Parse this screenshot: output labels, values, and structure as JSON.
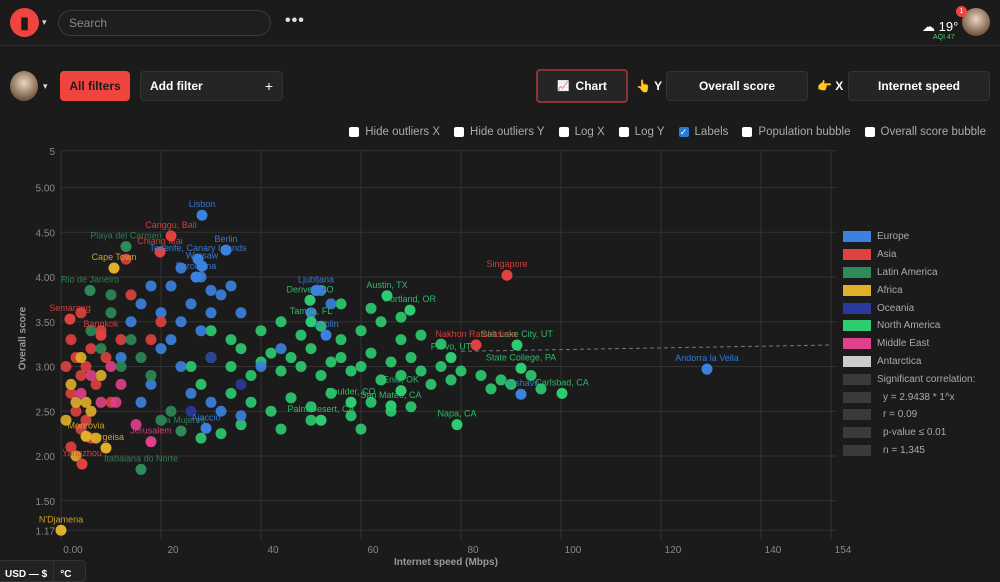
{
  "header": {
    "search_placeholder": "Search",
    "more": "•••",
    "temperature": "19°",
    "aqi": "AQI 47",
    "notifications": "1"
  },
  "toolbar": {
    "all_filters": "All filters",
    "add_filter": "Add filter",
    "add_icon": "+",
    "chart": "Chart",
    "chart_icon": "📈",
    "y_icon": "👆",
    "y_label": "Y",
    "y_value": "Overall score",
    "x_icon": "👉",
    "x_label": "X",
    "x_value": "Internet speed"
  },
  "options": [
    {
      "label": "Hide outliers X",
      "checked": false
    },
    {
      "label": "Hide outliers Y",
      "checked": false
    },
    {
      "label": "Log X",
      "checked": false
    },
    {
      "label": "Log Y",
      "checked": false
    },
    {
      "label": "Labels",
      "checked": true
    },
    {
      "label": "Population bubble",
      "checked": false
    },
    {
      "label": "Overall score bubble",
      "checked": false
    }
  ],
  "footer": {
    "currency": "USD — $",
    "unit": "°C"
  },
  "chart_data": {
    "type": "scatter",
    "xlabel": "Internet speed (Mbps)",
    "ylabel": "Overall score",
    "xlim": [
      0,
      154
    ],
    "ylim": [
      1.06,
      5.41
    ],
    "xticks": [
      {
        "v": 0,
        "t": "0.00"
      },
      {
        "v": 20,
        "t": "20"
      },
      {
        "v": 40,
        "t": "40"
      },
      {
        "v": 60,
        "t": "60"
      },
      {
        "v": 80,
        "t": "80"
      },
      {
        "v": 100,
        "t": "100"
      },
      {
        "v": 120,
        "t": "120"
      },
      {
        "v": 140,
        "t": "140"
      },
      {
        "v": 154,
        "t": "154"
      }
    ],
    "yticks": [
      {
        "v": 5.41,
        "t": "5"
      },
      {
        "v": 5,
        "t": "5.00"
      },
      {
        "v": 4.5,
        "t": "4.50"
      },
      {
        "v": 4,
        "t": "4.00"
      },
      {
        "v": 3.5,
        "t": "3.50"
      },
      {
        "v": 3,
        "t": "3.00"
      },
      {
        "v": 2.5,
        "t": "2.50"
      },
      {
        "v": 2,
        "t": "2.00"
      },
      {
        "v": 1.5,
        "t": "1.50"
      },
      {
        "v": 1.17,
        "t": "1.17"
      }
    ],
    "regions": [
      {
        "code": "E",
        "name": "Europe",
        "color": "#3b82e0"
      },
      {
        "code": "A",
        "name": "Asia",
        "color": "#e0433f"
      },
      {
        "code": "L",
        "name": "Latin America",
        "color": "#2e8a57"
      },
      {
        "code": "F",
        "name": "Africa",
        "color": "#e0b02a"
      },
      {
        "code": "O",
        "name": "Oceania",
        "color": "#2a3a9a"
      },
      {
        "code": "N",
        "name": "North America",
        "color": "#2ecc71"
      },
      {
        "code": "M",
        "name": "Middle East",
        "color": "#e0418a"
      },
      {
        "code": "X",
        "name": "Antarctica",
        "color": "#cccccc"
      }
    ],
    "correlation": [
      "Significant correlation:",
      "y = 2.9438 * 1^x",
      "r = 0.09",
      "p-value ≤ 0.01",
      "n = 1,345"
    ],
    "trendline": [
      [
        80,
        3.17
      ],
      [
        154,
        3.24
      ]
    ],
    "labeled_points": [
      [
        28.2,
        4.69,
        "E",
        "Lisbon"
      ],
      [
        22,
        4.46,
        "A",
        "Canggu, Bali"
      ],
      [
        13,
        4.34,
        "L",
        "Playa del Carmen"
      ],
      [
        19.8,
        4.28,
        "A",
        "Chiang Mai"
      ],
      [
        27.4,
        4.2,
        "E",
        "Tenerife, Canary Islands"
      ],
      [
        33,
        4.3,
        "E",
        "Berlin"
      ],
      [
        28.2,
        4.12,
        "E",
        "Warsaw"
      ],
      [
        10.6,
        4.1,
        "F",
        "Cape Town"
      ],
      [
        27,
        4.0,
        "E",
        "Barcelona"
      ],
      [
        89.2,
        4.02,
        "A",
        "Singapore"
      ],
      [
        65.2,
        3.79,
        "N",
        "Austin, TX"
      ],
      [
        69.8,
        3.63,
        "N",
        "Portland, OR"
      ],
      [
        91.2,
        3.24,
        "N",
        "Salt Lake City, UT"
      ],
      [
        129.2,
        2.97,
        "E",
        "Andorra la Vella"
      ],
      [
        100.2,
        2.7,
        "N",
        "Carlsbad, CA"
      ],
      [
        92,
        2.69,
        "E",
        "Torshavn"
      ],
      [
        79.2,
        2.35,
        "N",
        "Napa, CA"
      ],
      [
        49.8,
        3.74,
        "N",
        "Denver, CO"
      ],
      [
        51,
        3.85,
        "E",
        "Ljubljana"
      ],
      [
        18,
        2.16,
        "M",
        "Jerusalem"
      ],
      [
        5,
        2.22,
        "F",
        "Monrovia"
      ],
      [
        0,
        1.17,
        "F",
        "N'Djamena"
      ],
      [
        4.2,
        1.91,
        "A",
        "Yangzhou"
      ],
      [
        9,
        2.09,
        "F",
        "Hargeisa"
      ],
      [
        16,
        1.85,
        "L",
        "Itabaiana do Norte"
      ],
      [
        24,
        2.28,
        "L",
        "Isla Mujeres"
      ],
      [
        29,
        2.31,
        "E",
        "Ajaccio"
      ],
      [
        1.8,
        3.53,
        "A",
        "Semarang"
      ],
      [
        83,
        3.24,
        "A",
        "Nakhon Ratchasima"
      ],
      [
        78,
        3.1,
        "N",
        "Provo, UT"
      ],
      [
        68,
        2.73,
        "N",
        "Enid, OK"
      ],
      [
        66,
        2.56,
        "N",
        "San Mateo, CA"
      ],
      [
        52,
        2.4,
        "N",
        "Palm Desert, CA"
      ],
      [
        58,
        2.6,
        "N",
        "Boulder, CO"
      ],
      [
        53,
        3.35,
        "E",
        "Dublin"
      ],
      [
        50,
        3.5,
        "N",
        "Tampa, FL"
      ],
      [
        92,
        2.98,
        "N",
        "State College, PA"
      ],
      [
        5.8,
        3.85,
        "L",
        "Rio de Janeiro"
      ],
      [
        8,
        3.35,
        "A",
        "Bangkok"
      ]
    ],
    "points": {
      "N": [
        [
          30,
          3.1
        ],
        [
          34,
          3.0
        ],
        [
          36,
          3.2
        ],
        [
          38,
          2.9
        ],
        [
          40,
          3.05
        ],
        [
          42,
          3.15
        ],
        [
          44,
          2.95
        ],
        [
          46,
          3.1
        ],
        [
          48,
          3.0
        ],
        [
          50,
          3.2
        ],
        [
          52,
          2.9
        ],
        [
          54,
          3.05
        ],
        [
          56,
          3.1
        ],
        [
          58,
          2.95
        ],
        [
          60,
          3.0
        ],
        [
          62,
          3.15
        ],
        [
          64,
          2.85
        ],
        [
          66,
          3.05
        ],
        [
          68,
          2.9
        ],
        [
          70,
          3.1
        ],
        [
          72,
          2.95
        ],
        [
          74,
          2.8
        ],
        [
          76,
          3.0
        ],
        [
          78,
          2.85
        ],
        [
          80,
          2.95
        ],
        [
          84,
          2.9
        ],
        [
          86,
          2.75
        ],
        [
          88,
          2.85
        ],
        [
          90,
          2.8
        ],
        [
          94,
          2.9
        ],
        [
          96,
          2.75
        ],
        [
          34,
          2.7
        ],
        [
          38,
          2.6
        ],
        [
          42,
          2.5
        ],
        [
          46,
          2.65
        ],
        [
          50,
          2.55
        ],
        [
          54,
          2.7
        ],
        [
          58,
          2.45
        ],
        [
          62,
          2.6
        ],
        [
          66,
          2.5
        ],
        [
          70,
          2.55
        ],
        [
          40,
          3.4
        ],
        [
          44,
          3.5
        ],
        [
          48,
          3.35
        ],
        [
          52,
          3.45
        ],
        [
          56,
          3.3
        ],
        [
          60,
          3.4
        ],
        [
          64,
          3.5
        ],
        [
          68,
          3.3
        ],
        [
          72,
          3.35
        ],
        [
          76,
          3.25
        ],
        [
          36,
          2.35
        ],
        [
          44,
          2.3
        ],
        [
          50,
          2.4
        ],
        [
          32,
          2.25
        ],
        [
          28,
          2.2
        ],
        [
          60,
          2.3
        ],
        [
          56,
          3.7
        ],
        [
          62,
          3.65
        ],
        [
          68,
          3.55
        ],
        [
          30,
          3.4
        ],
        [
          34,
          3.3
        ],
        [
          26,
          3.0
        ],
        [
          28,
          2.8
        ]
      ],
      "E": [
        [
          20,
          3.6
        ],
        [
          24,
          3.5
        ],
        [
          22,
          3.3
        ],
        [
          26,
          3.7
        ],
        [
          28,
          3.4
        ],
        [
          30,
          3.6
        ],
        [
          32,
          3.8
        ],
        [
          34,
          3.9
        ],
        [
          36,
          3.6
        ],
        [
          18,
          3.9
        ],
        [
          16,
          3.7
        ],
        [
          14,
          3.5
        ],
        [
          22,
          3.9
        ],
        [
          24,
          4.1
        ],
        [
          28,
          4.0
        ],
        [
          30,
          3.85
        ],
        [
          20,
          3.2
        ],
        [
          24,
          3.0
        ],
        [
          26,
          2.7
        ],
        [
          30,
          2.6
        ],
        [
          32,
          2.5
        ],
        [
          36,
          2.45
        ],
        [
          16,
          2.6
        ],
        [
          18,
          2.8
        ],
        [
          12,
          3.1
        ],
        [
          40,
          3.0
        ],
        [
          44,
          3.2
        ],
        [
          50,
          3.6
        ],
        [
          54,
          3.7
        ],
        [
          52,
          3.85
        ]
      ],
      "A": [
        [
          2,
          3.3
        ],
        [
          3,
          3.1
        ],
        [
          4,
          2.9
        ],
        [
          5,
          3.0
        ],
        [
          6,
          3.2
        ],
        [
          2,
          2.7
        ],
        [
          3,
          2.5
        ],
        [
          5,
          2.4
        ],
        [
          7,
          2.8
        ],
        [
          8,
          3.4
        ],
        [
          4,
          3.6
        ],
        [
          1,
          3.0
        ],
        [
          9,
          3.1
        ],
        [
          10,
          2.6
        ],
        [
          12,
          3.3
        ],
        [
          14,
          3.8
        ],
        [
          18,
          3.3
        ],
        [
          20,
          3.5
        ],
        [
          13,
          4.2
        ],
        [
          6,
          2.2
        ],
        [
          2,
          2.1
        ],
        [
          4,
          2.3
        ]
      ],
      "F": [
        [
          2,
          2.8
        ],
        [
          3,
          2.6
        ],
        [
          1,
          2.4
        ],
        [
          5,
          2.6
        ],
        [
          7,
          2.2
        ],
        [
          4,
          3.1
        ],
        [
          8,
          2.9
        ],
        [
          6,
          2.5
        ],
        [
          3,
          2.0
        ]
      ],
      "M": [
        [
          4,
          2.7
        ],
        [
          6,
          2.9
        ],
        [
          8,
          2.6
        ],
        [
          10,
          3.0
        ],
        [
          12,
          2.8
        ],
        [
          15,
          2.35
        ],
        [
          11,
          2.6
        ]
      ],
      "L": [
        [
          6,
          3.4
        ],
        [
          8,
          3.2
        ],
        [
          10,
          3.6
        ],
        [
          12,
          3.0
        ],
        [
          14,
          3.3
        ],
        [
          16,
          3.1
        ],
        [
          18,
          2.9
        ],
        [
          10,
          3.8
        ],
        [
          22,
          2.5
        ],
        [
          20,
          2.4
        ]
      ],
      "O": [
        [
          30,
          3.1
        ],
        [
          36,
          2.8
        ],
        [
          26,
          2.5
        ]
      ]
    }
  }
}
